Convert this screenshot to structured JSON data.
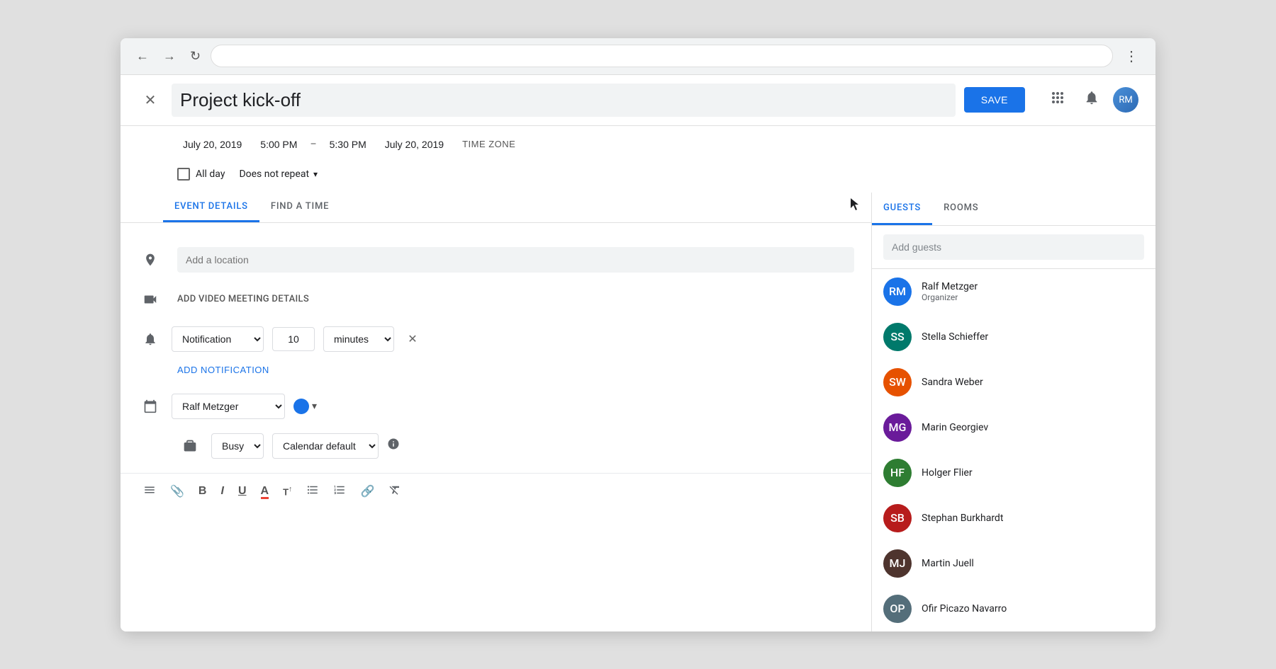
{
  "browser": {
    "url": ""
  },
  "header": {
    "title": "Project kick-off",
    "save_label": "SAVE",
    "close_icon": "✕"
  },
  "datetime": {
    "start_date": "July 20, 2019",
    "start_time": "5:00 PM",
    "separator": "–",
    "end_time": "5:30 PM",
    "end_date": "July 20, 2019",
    "timezone_label": "TIME ZONE"
  },
  "options": {
    "allday_label": "All day",
    "repeat_label": "Does not repeat",
    "repeat_arrow": "▾"
  },
  "tabs": {
    "event_details_label": "EVENT DETAILS",
    "find_a_time_label": "FIND A TIME"
  },
  "details": {
    "location_placeholder": "Add a location",
    "video_meeting_label": "ADD VIDEO MEETING DETAILS",
    "notification_type": "Notification",
    "notification_value": "10",
    "notification_unit": "minutes",
    "add_notification_label": "ADD NOTIFICATION",
    "calendar_owner": "Ralf Metzger",
    "status_label": "Busy",
    "visibility_label": "Calendar default"
  },
  "guests_panel": {
    "guests_tab_label": "GUESTS",
    "rooms_tab_label": "ROOMS",
    "add_guests_placeholder": "Add guests",
    "guests": [
      {
        "name": "Ralf Metzger",
        "role": "Organizer",
        "initials": "RM",
        "color": "av-blue"
      },
      {
        "name": "Stella Schieffer",
        "role": "",
        "initials": "SS",
        "color": "av-teal"
      },
      {
        "name": "Sandra Weber",
        "role": "",
        "initials": "SW",
        "color": "av-orange"
      },
      {
        "name": "Marin Georgiev",
        "role": "",
        "initials": "MG",
        "color": "av-purple"
      },
      {
        "name": "Holger Flier",
        "role": "",
        "initials": "HF",
        "color": "av-green"
      },
      {
        "name": "Stephan Burkhardt",
        "role": "",
        "initials": "SB",
        "color": "av-red"
      },
      {
        "name": "Martin Juell",
        "role": "",
        "initials": "MJ",
        "color": "av-brown"
      },
      {
        "name": "Ofir Picazo Navarro",
        "role": "",
        "initials": "OP",
        "color": "av-gray"
      }
    ]
  },
  "toolbar": {
    "desc_icon": "≡",
    "attach_icon": "📎",
    "bold_icon": "B",
    "italic_icon": "I",
    "underline_icon": "U",
    "text_color_icon": "A",
    "text_size_icon": "T↑",
    "bullet_icon": "•≡",
    "numbered_icon": "1≡",
    "link_icon": "🔗",
    "clear_icon": "✕"
  },
  "icons": {
    "location": "📍",
    "video": "🎥",
    "bell": "🔔",
    "calendar": "📅",
    "briefcase": "💼",
    "apps": "⊞",
    "notifications_bell": "🔔"
  }
}
